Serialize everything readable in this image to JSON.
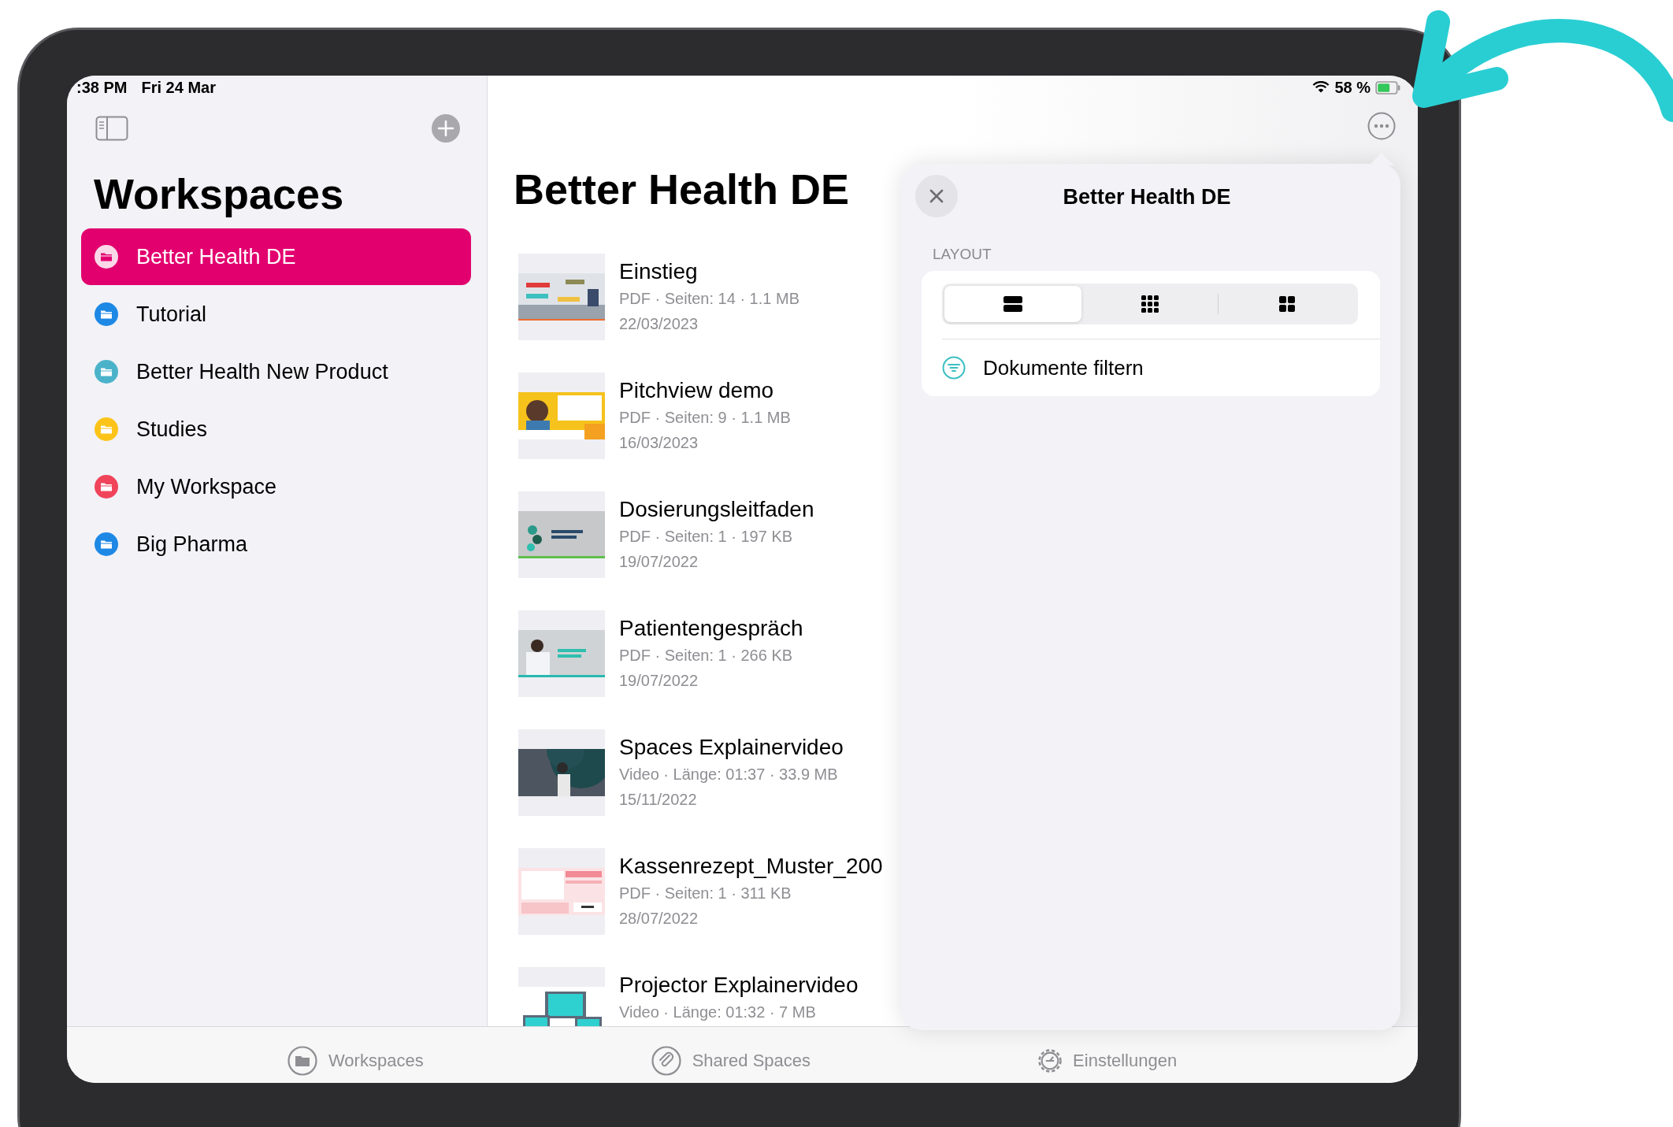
{
  "status_bar": {
    "time": ":38 PM",
    "date": "Fri 24 Mar",
    "battery": "58 %"
  },
  "sidebar": {
    "title": "Workspaces",
    "items": [
      {
        "label": "Better Health DE",
        "color": "#e2006f",
        "selected": true
      },
      {
        "label": "Tutorial",
        "color": "#1e88e5",
        "selected": false
      },
      {
        "label": "Better Health New Product",
        "color": "#4bb3c9",
        "selected": false
      },
      {
        "label": "Studies",
        "color": "#fcc419",
        "selected": false
      },
      {
        "label": "My Workspace",
        "color": "#f0445a",
        "selected": false
      },
      {
        "label": "Big Pharma",
        "color": "#1e88e5",
        "selected": false
      }
    ]
  },
  "main": {
    "title": "Better Health DE",
    "documents": [
      {
        "title": "Einstieg",
        "meta": "PDF · Seiten: 14 · 1.1 MB",
        "date": "22/03/2023"
      },
      {
        "title": "Pitchview demo",
        "meta": "PDF · Seiten: 9 · 1.1 MB",
        "date": "16/03/2023"
      },
      {
        "title": "Dosierungsleitfaden",
        "meta": "PDF · Seiten: 1 · 197 KB",
        "date": "19/07/2022"
      },
      {
        "title": "Patientengespräch",
        "meta": "PDF · Seiten: 1 · 266 KB",
        "date": "19/07/2022"
      },
      {
        "title": "Spaces Explainervideo",
        "meta": "Video · Länge: 01:37 · 33.9 MB",
        "date": "15/11/2022"
      },
      {
        "title": "Kassenrezept_Muster_200",
        "meta": "PDF · Seiten: 1 · 311 KB",
        "date": "28/07/2022"
      },
      {
        "title": "Projector Explainervideo",
        "meta": "Video · Länge: 01:32 · 7 MB"
      }
    ]
  },
  "popover": {
    "title": "Better Health DE",
    "section_label": "LAYOUT",
    "layout_options": [
      {
        "kind": "rows",
        "selected": true
      },
      {
        "kind": "grid-small",
        "selected": false
      },
      {
        "kind": "grid-large",
        "selected": false
      }
    ],
    "filter_label": "Dokumente filtern"
  },
  "tab_bar": [
    {
      "label": "Workspaces",
      "kind": "folder"
    },
    {
      "label": "Shared Spaces",
      "kind": "paperclip"
    },
    {
      "label": "Einstellungen",
      "kind": "gear"
    }
  ]
}
